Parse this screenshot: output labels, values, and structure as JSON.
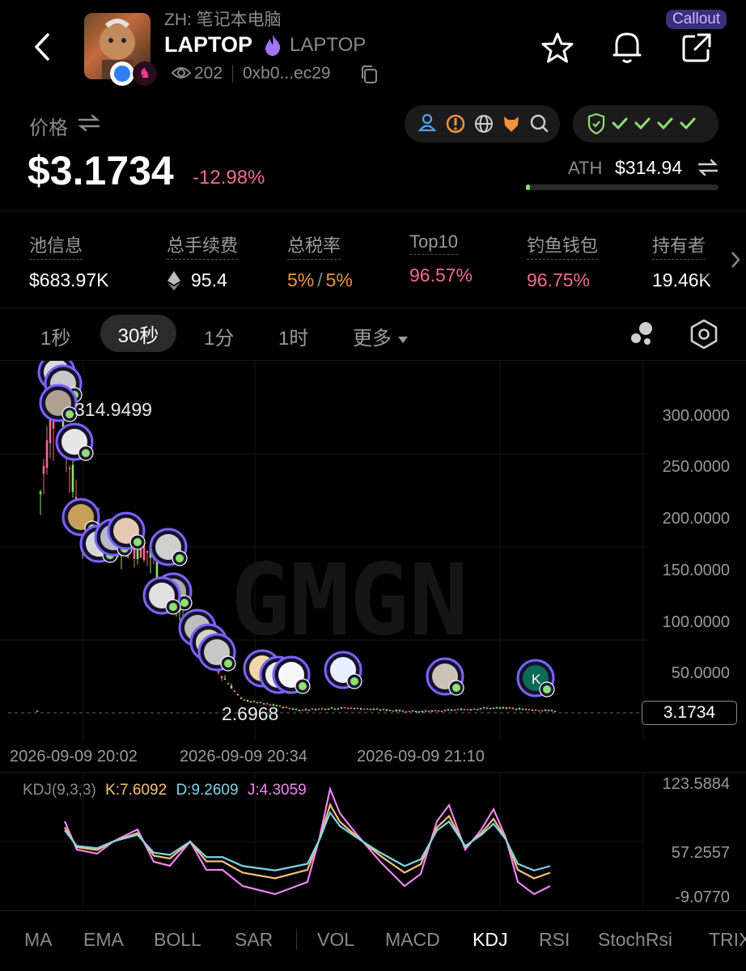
{
  "header": {
    "subtitle": "ZH: 笔记本电脑",
    "name": "LAPTOP",
    "symbol": "LAPTOP",
    "views": "202",
    "address": "0xb0...ec29",
    "callout": "Callout"
  },
  "price": {
    "label": "价格",
    "value": "$3.1734",
    "change": "-12.98%",
    "ath_label": "ATH",
    "ath_value": "$314.94"
  },
  "stats": [
    {
      "label": "池信息",
      "value": "$683.97K"
    },
    {
      "label": "总手续费",
      "value": "95.4"
    },
    {
      "label": "总税率",
      "value_a": "5%",
      "sep": "/",
      "value_b": "5%"
    },
    {
      "label": "Top10",
      "value": "96.57%"
    },
    {
      "label": "钓鱼钱包",
      "value": "96.75%"
    },
    {
      "label": "持有者",
      "value": "19.46K"
    }
  ],
  "timeframes": [
    "1秒",
    "30秒",
    "1分",
    "1时",
    "更多"
  ],
  "active_timeframe": "30秒",
  "chart": {
    "watermark": "GMGN",
    "peak_label": "314.9499",
    "low_label": "2.6968",
    "current_price": "3.1734",
    "y_ticks": [
      "300.0000",
      "250.0000",
      "200.0000",
      "150.0000",
      "100.0000",
      "50.0000"
    ],
    "x_ticks": [
      "2026-09-09 20:02",
      "2026-09-09 20:34",
      "2026-09-09 21:10"
    ],
    "avatar_badge": "K"
  },
  "kdj": {
    "title": "KDJ(9,3,3)",
    "k": "K:7.6092",
    "d": "D:9.2609",
    "j": "J:4.3059",
    "y_ticks": [
      "123.5884",
      "57.2557",
      "-9.0770"
    ]
  },
  "indicators": [
    "MA",
    "EMA",
    "BOLL",
    "SAR",
    "VOL",
    "MACD",
    "KDJ",
    "RSI",
    "StochRsi",
    "TRIX"
  ],
  "active_indicator": "KDJ",
  "colors": {
    "up": "#8fe06e",
    "down": "#f06c8a",
    "accent": "#7c62ff",
    "k": "#f4c07a",
    "d": "#7fd3e8",
    "j": "#ee84f0"
  }
}
